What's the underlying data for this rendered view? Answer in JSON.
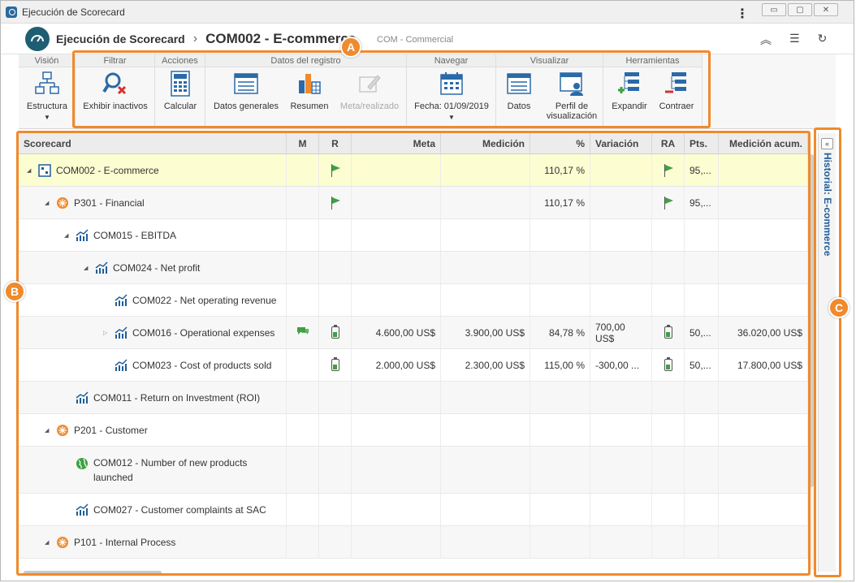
{
  "window": {
    "title": "Ejecución de Scorecard"
  },
  "header": {
    "crumb_root": "Ejecución de Scorecard",
    "crumb_current": "COM002 - E-commerce",
    "subtitle": "COM - Commercial"
  },
  "ribbon": {
    "groups": {
      "vision": "Visión",
      "filtrar": "Filtrar",
      "acciones": "Acciones",
      "datos_registro": "Datos del registro",
      "navegar": "Navegar",
      "visualizar": "Visualizar",
      "herramientas": "Herramientas"
    },
    "buttons": {
      "estructura": "Estructura",
      "exhibir_inactivos": "Exhibir inactivos",
      "calcular": "Calcular",
      "datos_generales": "Datos generales",
      "resumen": "Resumen",
      "meta_realizado": "Meta/realizado",
      "fecha": "Fecha: 01/09/2019",
      "datos": "Datos",
      "perfil_1": "Perfil de",
      "perfil_2": "visualización",
      "expandir": "Expandir",
      "contraer": "Contraer"
    }
  },
  "grid": {
    "columns": {
      "scorecard": "Scorecard",
      "m": "M",
      "r": "R",
      "meta": "Meta",
      "medicion": "Medición",
      "pct": "%",
      "variacion": "Variación",
      "ra": "RA",
      "pts": "Pts.",
      "medicion_acum": "Medición acum."
    },
    "rows": [
      {
        "label": "COM002 - E-commerce",
        "pct": "110,17 %",
        "pts": "95,..."
      },
      {
        "label": "P301 - Financial",
        "pct": "110,17 %",
        "pts": "95,..."
      },
      {
        "label": "COM015 - EBITDA"
      },
      {
        "label": "COM024 - Net profit"
      },
      {
        "label": "COM022 - Net operating revenue"
      },
      {
        "label": "COM016 - Operational expenses",
        "meta": "4.600,00 US$",
        "medicion": "3.900,00 US$",
        "pct": "84,78 %",
        "variacion": "700,00 US$",
        "pts": "50,...",
        "acum": "36.020,00 US$"
      },
      {
        "label": "COM023 - Cost of products sold",
        "meta": "2.000,00 US$",
        "medicion": "2.300,00 US$",
        "pct": "115,00 %",
        "variacion": "-300,00 ...",
        "pts": "50,...",
        "acum": "17.800,00 US$"
      },
      {
        "label": "COM011 - Return on Investment (ROI)"
      },
      {
        "label": "P201 - Customer"
      },
      {
        "label_1": "COM012 - Number of new products",
        "label_2": "launched"
      },
      {
        "label": "COM027 - Customer complaints at SAC"
      },
      {
        "label": "P101 - Internal Process"
      }
    ]
  },
  "side_panel": {
    "label": "Historial: E-commerce"
  },
  "callouts": {
    "a": "A",
    "b": "B",
    "c": "C"
  },
  "colors": {
    "accent": "#f08a2c",
    "selected_row": "#fdfdd2",
    "flag": "#3da142",
    "link": "#1f5d99"
  }
}
